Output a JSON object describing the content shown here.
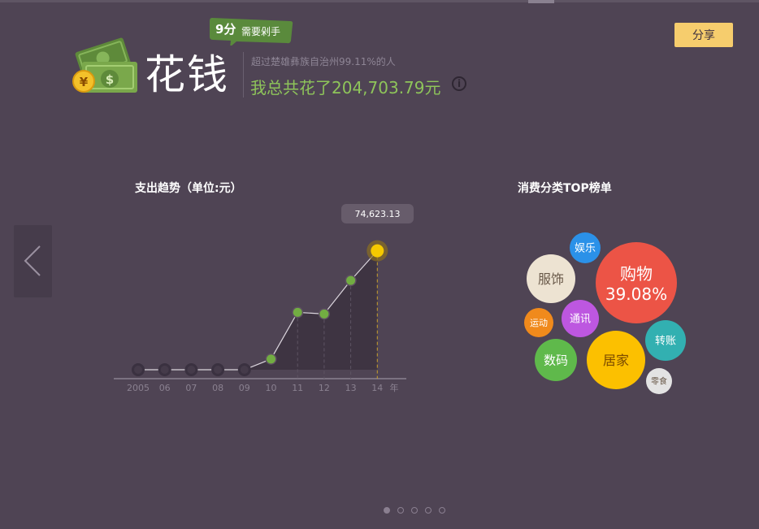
{
  "header": {
    "score": "9分",
    "score_note": "需要剁手",
    "title": "花钱",
    "exceed_text": "超过楚雄彝族自治州99.11%的人",
    "total_text": "我总共花了204,703.79元",
    "info_glyph": "i",
    "share_label": "分享"
  },
  "colors": {
    "background": "#4f4454",
    "green": "#8ec45a",
    "point_highlight": "#f5c900",
    "share_bg": "#f6cd6d"
  },
  "trend": {
    "title": "支出趋势（单位:元）",
    "tooltip": "74,623.13"
  },
  "chart_data": {
    "type": "area",
    "title": "支出趋势（单位:元）",
    "x": [
      "2005",
      "06",
      "07",
      "08",
      "09",
      "10",
      "11",
      "12",
      "13",
      "14"
    ],
    "x_unit": "年",
    "values": [
      0,
      0,
      0,
      0,
      0,
      6700,
      36000,
      35000,
      56000,
      74623.13
    ],
    "highlight_label": "74,623.13",
    "ylim": [
      0,
      78000
    ]
  },
  "categories": {
    "title": "消费分类TOP榜单",
    "items": [
      {
        "label": "购物",
        "value": "39.08%",
        "color": "#ec5446"
      },
      {
        "label": "居家",
        "value": "",
        "color": "#fcc000"
      },
      {
        "label": "服饰",
        "value": "",
        "color": "#ede3d2"
      },
      {
        "label": "数码",
        "value": "",
        "color": "#5fb94b"
      },
      {
        "label": "转账",
        "value": "",
        "color": "#32b0b1"
      },
      {
        "label": "通讯",
        "value": "",
        "color": "#bd57e0"
      },
      {
        "label": "娱乐",
        "value": "",
        "color": "#2b91e8"
      },
      {
        "label": "运动",
        "value": "",
        "color": "#f08a1c"
      },
      {
        "label": "零食",
        "value": "",
        "color": "#e3e3e3"
      }
    ]
  },
  "pager": {
    "count": 5,
    "active": 0
  }
}
